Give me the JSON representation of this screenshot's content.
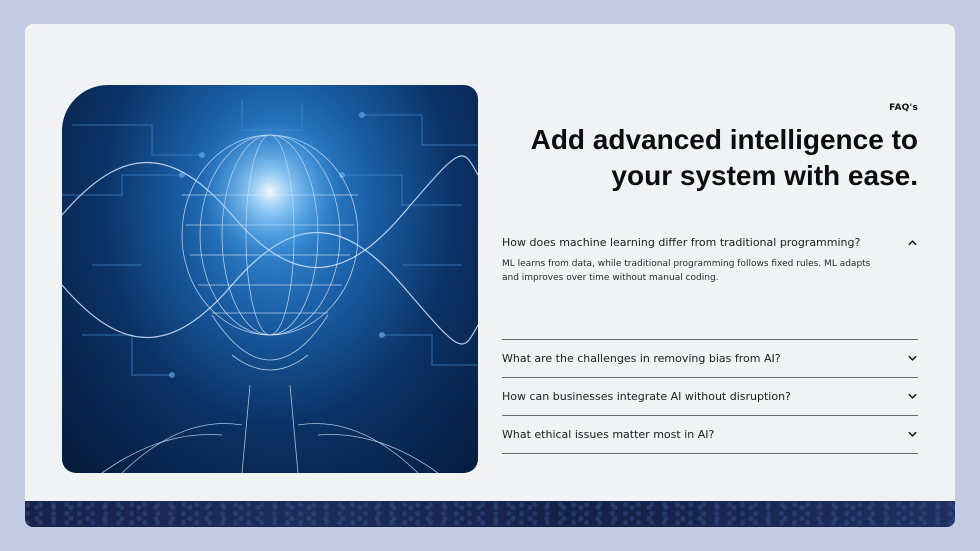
{
  "section": {
    "eyebrow": "FAQ's",
    "headline_line1": "Add advanced intelligence to",
    "headline_line2": "your system with ease."
  },
  "hero_image": {
    "alt": "AI wireframe head"
  },
  "faq": {
    "items": [
      {
        "question": "How does machine learning differ from traditional programming?",
        "answer": "ML learns from data, while traditional programming follows fixed rules. ML adapts and improves over time without manual coding.",
        "expanded": true,
        "icon": "chevron-up-icon"
      },
      {
        "question": "What are the challenges in removing bias from AI?",
        "expanded": false,
        "icon": "chevron-down-icon"
      },
      {
        "question": "How can businesses integrate AI without disruption?",
        "expanded": false,
        "icon": "chevron-down-icon"
      },
      {
        "question": "What ethical issues matter most in AI?",
        "expanded": false,
        "icon": "chevron-down-icon"
      }
    ]
  },
  "colors": {
    "page_bg": "#c2cbe3",
    "card_bg": "#f1f2f4",
    "footer_band": "#1a2a58",
    "hero_glow": "#3f9ae6"
  }
}
